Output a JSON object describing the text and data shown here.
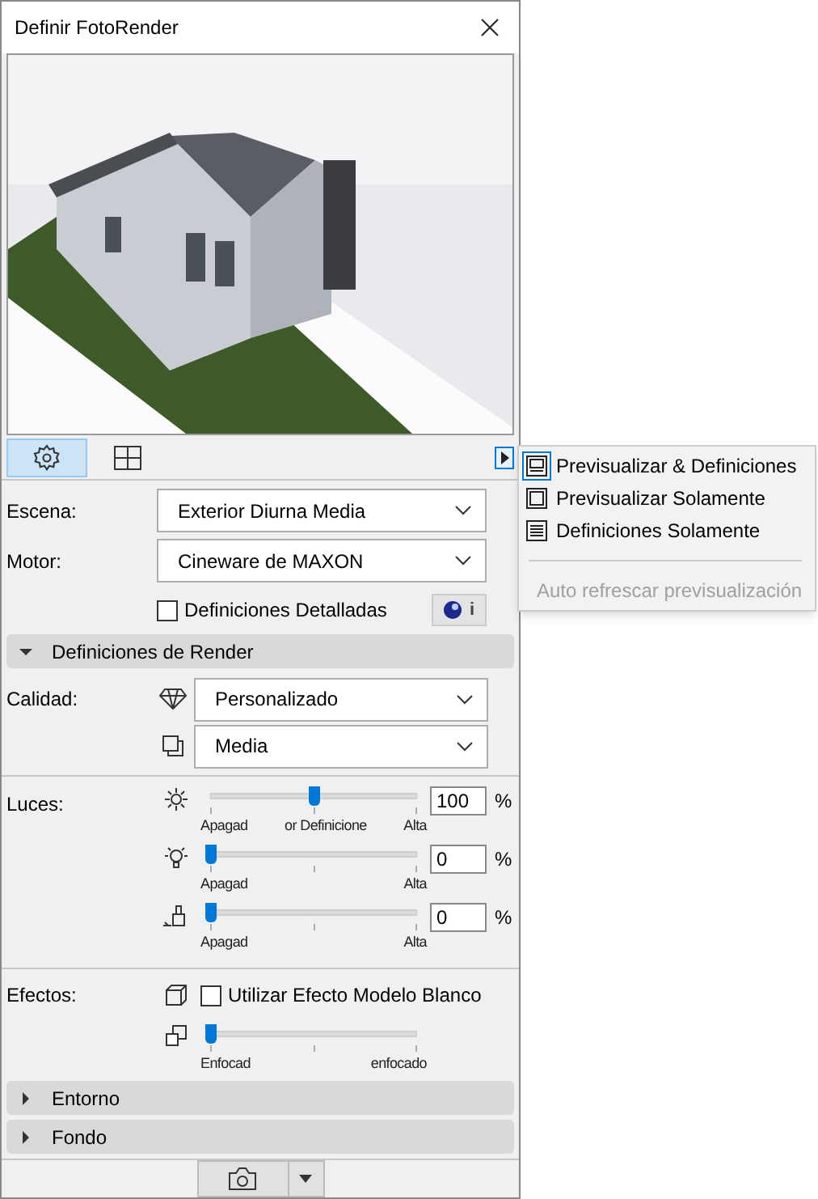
{
  "window": {
    "title": "Definir FotoRender"
  },
  "tabs": [
    {
      "kind": "settings",
      "selected": true
    },
    {
      "kind": "layout",
      "selected": false
    }
  ],
  "view_menu": {
    "items": [
      {
        "kind": "both",
        "label": "Previsualizar & Definiciones",
        "selected": true
      },
      {
        "kind": "preview",
        "label": "Previsualizar Solamente",
        "selected": false
      },
      {
        "kind": "settings",
        "label": "Definiciones Solamente",
        "selected": false
      }
    ],
    "auto_refresh": {
      "label": "Auto refrescar previsualización",
      "disabled": true
    }
  },
  "scene": {
    "label": "Escena:",
    "value": "Exterior Diurna Media"
  },
  "engine": {
    "label": "Motor:",
    "value": "Cineware de MAXON"
  },
  "detailed": {
    "label": "Definiciones Detalladas",
    "checked": false
  },
  "info_button": {
    "label": "i"
  },
  "render_section": {
    "label": "Definiciones de Render",
    "expanded": true
  },
  "quality": {
    "label": "Calidad:",
    "dropdowns": [
      {
        "kind": "diamond",
        "value": "Personalizado"
      },
      {
        "kind": "shadow",
        "value": "Media"
      }
    ]
  },
  "lights": {
    "label": "Luces:",
    "sliders": [
      {
        "kind": "sun",
        "level": 0.5,
        "value": "100",
        "unit": "%",
        "ticks": [
          "Apagad",
          "or Definicione",
          "Alta"
        ]
      },
      {
        "kind": "bulb",
        "level": 0,
        "value": "0",
        "unit": "%",
        "ticks": [
          "Apagad",
          "Alta"
        ]
      },
      {
        "kind": "brush",
        "level": 0,
        "value": "0",
        "unit": "%",
        "ticks": [
          "Apagad",
          "Alta"
        ]
      }
    ]
  },
  "effects": {
    "label": "Efectos:",
    "white_model": {
      "label": "Utilizar Efecto Modelo Blanco",
      "checked": false
    },
    "blur": {
      "level": 0,
      "ticks": [
        "Enfocad",
        "enfocado"
      ]
    }
  },
  "collapsed_sections": [
    {
      "label": "Entorno",
      "expanded": false
    },
    {
      "label": "Fondo",
      "expanded": false
    }
  ]
}
